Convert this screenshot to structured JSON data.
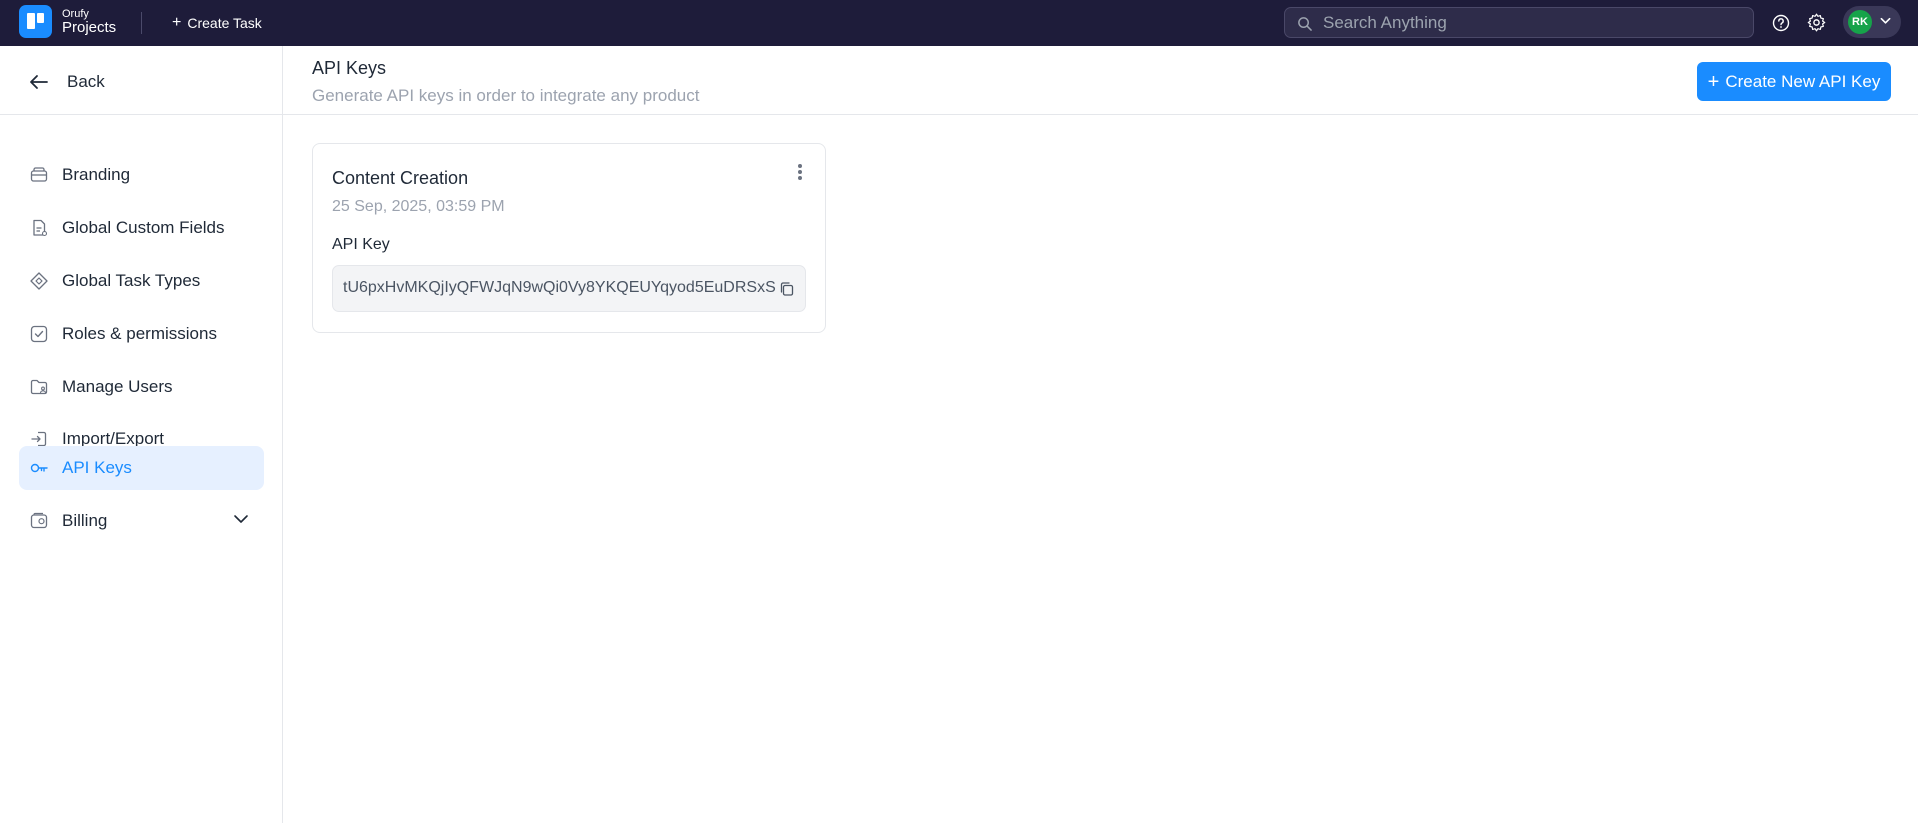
{
  "brand": {
    "company": "Orufy",
    "product": "Projects"
  },
  "topbar": {
    "create_task_label": "Create Task",
    "search_placeholder": "Search Anything",
    "user_initials": "RK"
  },
  "sidebar": {
    "back_label": "Back",
    "items": [
      {
        "label": "Branding",
        "icon": "branding-icon"
      },
      {
        "label": "Global Custom Fields",
        "icon": "document-icon"
      },
      {
        "label": "Global Task Types",
        "icon": "diamond-icon"
      },
      {
        "label": "Roles & permissions",
        "icon": "checkbox-icon"
      },
      {
        "label": "Manage Users",
        "icon": "folder-user-icon"
      },
      {
        "label": "Import/Export",
        "icon": "import-icon"
      },
      {
        "label": "API Keys",
        "icon": "key-icon",
        "active": true
      },
      {
        "label": "Billing",
        "icon": "wallet-icon",
        "expandable": true
      }
    ]
  },
  "main": {
    "title": "API Keys",
    "subtitle": "Generate API keys in order to integrate any product",
    "create_button_label": "Create New API Key",
    "cards": [
      {
        "name": "Content Creation",
        "date": "25 Sep, 2025, 03:59 PM",
        "key_label": "API Key",
        "key_value": "tU6pxHvMKQjIyQFWJqN9wQi0Vy8YKQEUYqyod5EuDRSxS"
      }
    ]
  },
  "colors": {
    "topbar_bg": "#1e1c3a",
    "accent": "#1a8cff",
    "active_bg": "#e6f0ff",
    "avatar_bg": "#16a34a"
  }
}
